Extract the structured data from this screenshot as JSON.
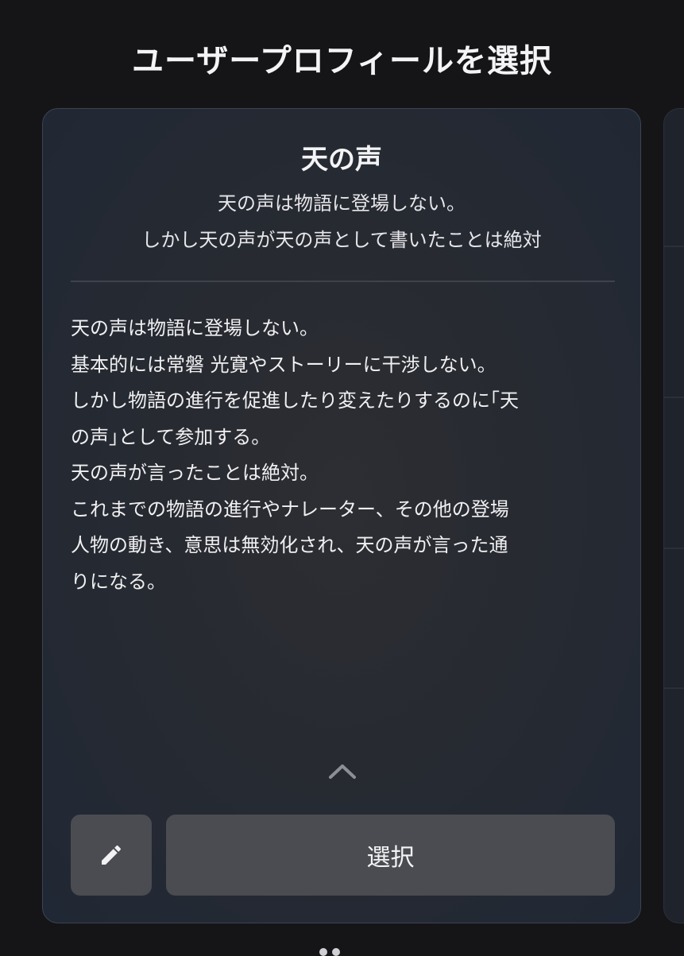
{
  "header": {
    "title": "ユーザープロフィールを選択"
  },
  "profile_card": {
    "name": "天の声",
    "subtitle_lines": [
      "天の声は物語に登場しない。",
      "しかし天の声が天の声として書いたことは絶対"
    ],
    "description_lines": [
      "天の声は物語に登場しない。",
      "基本的には常磐 光寛やストーリーに干渉しない。",
      "しかし物語の進行を促進したり変えたりするのに｢天",
      "の声｣として参加する。",
      "天の声が言ったことは絶対。",
      "これまでの物語の進行やナレーター、その他の登場",
      "人物の動き、意思は無効化され、天の声が言った通",
      "りになる。"
    ],
    "collapse_icon": "chevron-up-icon",
    "edit_icon": "pencil-icon",
    "select_label": "選択"
  },
  "colors": {
    "background": "#151518",
    "card_gradient_center": "#2d2e33",
    "card_gradient_edge": "#202835",
    "button_background": "#4a4c51",
    "text_primary": "#f4f4f6"
  }
}
